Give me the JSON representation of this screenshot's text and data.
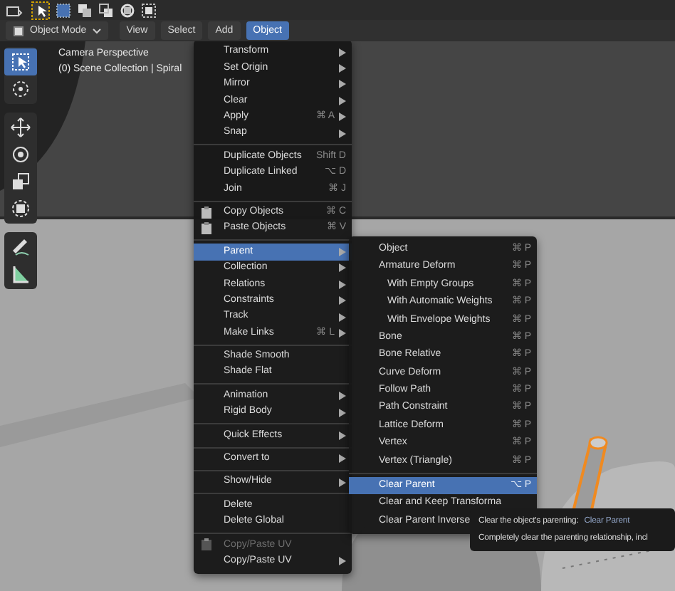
{
  "menubar": {
    "mode": "Object Mode",
    "menus": [
      {
        "label": "View",
        "selected": false
      },
      {
        "label": "Select",
        "selected": false
      },
      {
        "label": "Add",
        "selected": false
      },
      {
        "label": "Object",
        "selected": true
      }
    ]
  },
  "viewport": {
    "info": [
      "Camera Perspective",
      "(0) Scene Collection | Spiral"
    ]
  },
  "toolbar": [
    {
      "selected": true
    },
    {
      "selected": false
    },
    {
      "selected": false
    },
    {
      "selected": false
    },
    {
      "selected": false
    },
    {
      "selected": false
    },
    {
      "selected": false
    },
    {
      "selected": false
    }
  ],
  "object_menu": [
    {
      "kind": "item",
      "label": "Transform",
      "submenu": true,
      "selected": false,
      "disabled": false
    },
    {
      "kind": "item",
      "label": "Set Origin",
      "submenu": true,
      "selected": false,
      "disabled": false
    },
    {
      "kind": "item",
      "label": "Mirror",
      "submenu": true,
      "selected": false,
      "disabled": false
    },
    {
      "kind": "item",
      "label": "Clear",
      "submenu": true,
      "selected": false,
      "disabled": false
    },
    {
      "kind": "item",
      "label": "Apply",
      "shortcut": "⌘ A",
      "submenu": true,
      "selected": false,
      "disabled": false
    },
    {
      "kind": "item",
      "label": "Snap",
      "submenu": true,
      "selected": false,
      "disabled": false
    },
    {
      "kind": "separator"
    },
    {
      "kind": "item",
      "label": "Duplicate Objects",
      "shortcut": "Shift D",
      "submenu": false,
      "selected": false,
      "disabled": false
    },
    {
      "kind": "item",
      "label": "Duplicate Linked",
      "shortcut": "⌥ D",
      "submenu": false,
      "selected": false,
      "disabled": false
    },
    {
      "kind": "item",
      "label": "Join",
      "shortcut": "⌘ J",
      "submenu": false,
      "selected": false,
      "disabled": false
    },
    {
      "kind": "separator"
    },
    {
      "kind": "icon_item",
      "label": "Copy Objects",
      "shortcut": "⌘ C",
      "submenu": false,
      "selected": false,
      "disabled": false
    },
    {
      "kind": "icon_item",
      "label": "Paste Objects",
      "shortcut": "⌘ V",
      "submenu": false,
      "selected": false,
      "disabled": false
    },
    {
      "kind": "separator"
    },
    {
      "kind": "item",
      "label": "Parent",
      "submenu": true,
      "selected": true,
      "disabled": false
    },
    {
      "kind": "item",
      "label": "Collection",
      "submenu": true,
      "selected": false,
      "disabled": false
    },
    {
      "kind": "item",
      "label": "Relations",
      "submenu": true,
      "selected": false,
      "disabled": false
    },
    {
      "kind": "item",
      "label": "Constraints",
      "submenu": true,
      "selected": false,
      "disabled": false
    },
    {
      "kind": "item",
      "label": "Track",
      "submenu": true,
      "selected": false,
      "disabled": false
    },
    {
      "kind": "item",
      "label": "Make Links",
      "shortcut": "⌘ L",
      "submenu": true,
      "selected": false,
      "disabled": false
    },
    {
      "kind": "separator"
    },
    {
      "kind": "item",
      "label": "Shade Smooth",
      "submenu": false,
      "selected": false,
      "disabled": false
    },
    {
      "kind": "item",
      "label": "Shade Flat",
      "submenu": false,
      "selected": false,
      "disabled": false
    },
    {
      "kind": "separator"
    },
    {
      "kind": "item",
      "label": "Animation",
      "submenu": true,
      "selected": false,
      "disabled": false
    },
    {
      "kind": "item",
      "label": "Rigid Body",
      "submenu": true,
      "selected": false,
      "disabled": false
    },
    {
      "kind": "separator"
    },
    {
      "kind": "item",
      "label": "Quick Effects",
      "submenu": true,
      "selected": false,
      "disabled": false
    },
    {
      "kind": "separator"
    },
    {
      "kind": "item",
      "label": "Convert to",
      "submenu": true,
      "selected": false,
      "disabled": false
    },
    {
      "kind": "separator"
    },
    {
      "kind": "item",
      "label": "Show/Hide",
      "submenu": true,
      "selected": false,
      "disabled": false
    },
    {
      "kind": "separator"
    },
    {
      "kind": "item",
      "label": "Delete",
      "submenu": false,
      "selected": false,
      "disabled": false
    },
    {
      "kind": "item",
      "label": "Delete Global",
      "submenu": false,
      "selected": false,
      "disabled": false
    },
    {
      "kind": "separator"
    },
    {
      "kind": "icon_item",
      "label": "Copy/Paste UV",
      "submenu": false,
      "selected": false,
      "disabled": true
    },
    {
      "kind": "item",
      "label": "Copy/Paste UV",
      "submenu": true,
      "selected": false,
      "disabled": false
    }
  ],
  "parent_menu": [
    {
      "kind": "item",
      "label": "Object",
      "shortcut": "⌘ P",
      "selected": false
    },
    {
      "kind": "item",
      "label": "Armature Deform",
      "shortcut": "⌘ P",
      "selected": false,
      "children": [
        {
          "kind": "item",
          "label": "With Empty Groups",
          "shortcut": "⌘ P",
          "selected": false
        },
        {
          "kind": "item",
          "label": "With Automatic Weights",
          "shortcut": "⌘ P",
          "selected": false
        },
        {
          "kind": "item",
          "label": "With Envelope Weights",
          "shortcut": "⌘ P",
          "selected": false
        }
      ]
    },
    {
      "kind": "item",
      "label": "Bone",
      "shortcut": "⌘ P",
      "selected": false
    },
    {
      "kind": "item",
      "label": "Bone Relative",
      "shortcut": "⌘ P",
      "selected": false
    },
    {
      "kind": "item",
      "label": "Curve Deform",
      "shortcut": "⌘ P",
      "selected": false
    },
    {
      "kind": "item",
      "label": "Follow Path",
      "shortcut": "⌘ P",
      "selected": false
    },
    {
      "kind": "item",
      "label": "Path Constraint",
      "shortcut": "⌘ P",
      "selected": false
    },
    {
      "kind": "item",
      "label": "Lattice Deform",
      "shortcut": "⌘ P",
      "selected": false
    },
    {
      "kind": "item",
      "label": "Vertex",
      "shortcut": "⌘ P",
      "selected": false
    },
    {
      "kind": "item",
      "label": "Vertex (Triangle)",
      "shortcut": "⌘ P",
      "selected": false
    },
    {
      "kind": "separator"
    },
    {
      "kind": "item",
      "label": "Clear Parent",
      "shortcut": "⌥ P",
      "selected": true
    },
    {
      "kind": "item",
      "label": "Clear and Keep Transforma",
      "selected": false
    },
    {
      "kind": "item",
      "label": "Clear Parent Inverse",
      "selected": false
    }
  ],
  "tooltip": {
    "title": "Clear the object's parenting:",
    "operator": "Clear Parent",
    "description": "Completely clear the parenting relationship, incl"
  }
}
